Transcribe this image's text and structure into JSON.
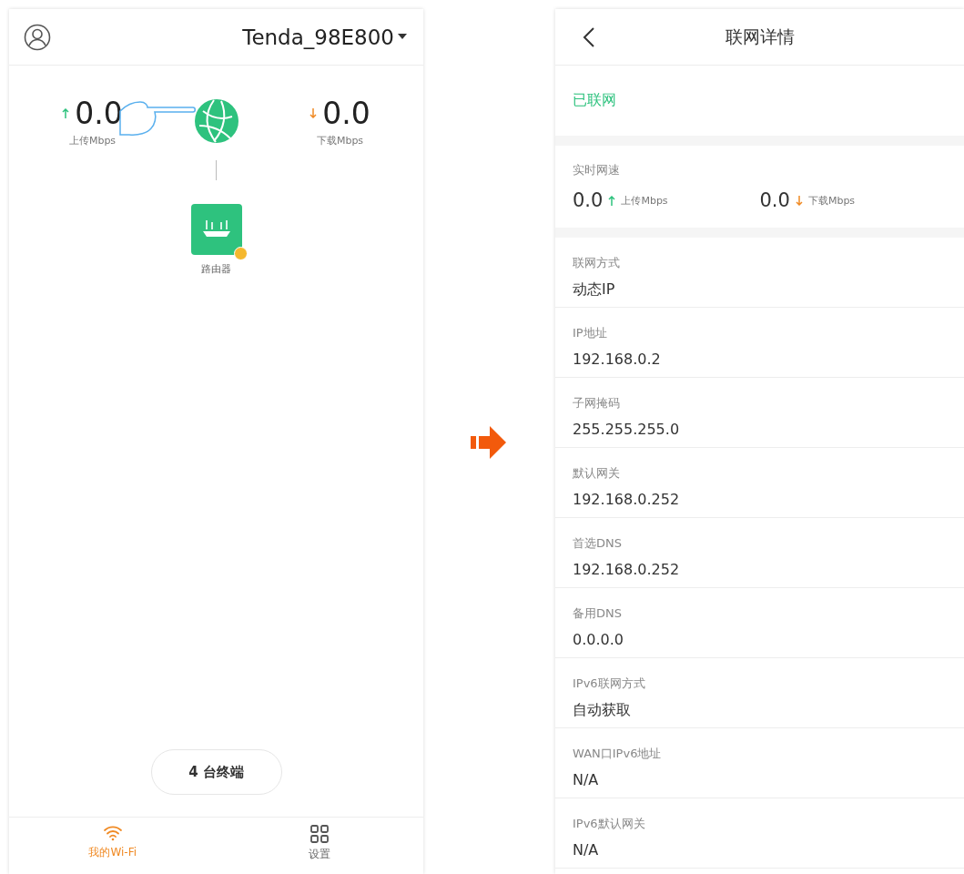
{
  "home_screen": {
    "network_name": "Tenda_98E800",
    "upload": {
      "value": "0.0",
      "unit": "上传Mbps"
    },
    "download": {
      "value": "0.0",
      "unit": "下载Mbps"
    },
    "device": {
      "label": "路由器"
    },
    "terminals_button": "4 台终端",
    "tabs": [
      {
        "label": "我的Wi-Fi",
        "kind": "wifi",
        "selected": true
      },
      {
        "label": "设置",
        "kind": "grid",
        "selected": false
      }
    ]
  },
  "details_screen": {
    "title": "联网详情",
    "status": "已联网",
    "speed": {
      "title": "实时网速",
      "upload": {
        "value": "0.0",
        "unit": "上传Mbps"
      },
      "download": {
        "value": "0.0",
        "unit": "下载Mbps"
      }
    },
    "fields": [
      {
        "label": "联网方式",
        "value": "动态IP"
      },
      {
        "label": "IP地址",
        "value": "192.168.0.2"
      },
      {
        "label": "子网掩码",
        "value": "255.255.255.0"
      },
      {
        "label": "默认网关",
        "value": "192.168.0.252"
      },
      {
        "label": "首选DNS",
        "value": "192.168.0.252"
      },
      {
        "label": "备用DNS",
        "value": "0.0.0.0"
      },
      {
        "label": "IPv6联网方式",
        "value": "自动获取"
      },
      {
        "label": "WAN口IPv6地址",
        "value": "N/A"
      },
      {
        "label": "IPv6默认网关",
        "value": "N/A"
      }
    ]
  }
}
